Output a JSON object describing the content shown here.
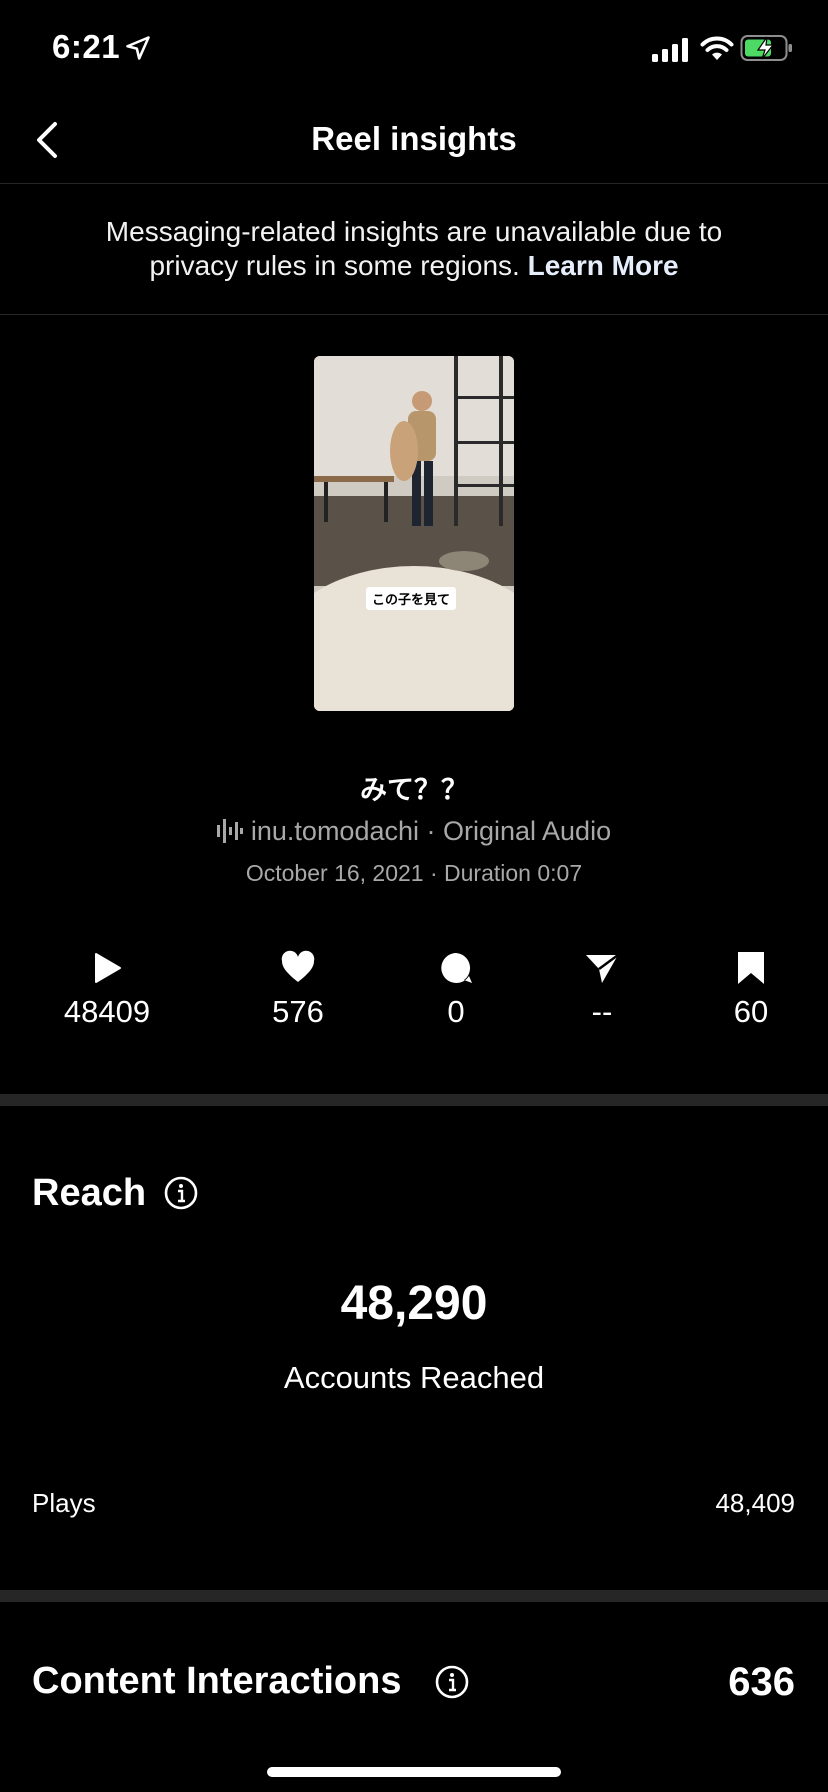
{
  "status_bar": {
    "time": "6:21"
  },
  "nav": {
    "title": "Reel insights"
  },
  "banner": {
    "text": "Messaging-related insights are unavailable due to privacy rules in some regions.",
    "link": "Learn More"
  },
  "reel": {
    "thumbnail_caption": "この子を見て",
    "title": "みて？？",
    "audio": "inu.tomodachi · Original Audio",
    "meta": "October 16, 2021 · Duration 0:07"
  },
  "stats": {
    "plays": "48409",
    "likes": "576",
    "comments": "0",
    "shares": "--",
    "saves": "60"
  },
  "reach": {
    "title": "Reach",
    "accounts_reached_value": "48,290",
    "accounts_reached_label": "Accounts Reached",
    "plays_label": "Plays",
    "plays_value": "48,409"
  },
  "interactions": {
    "title": "Content Interactions",
    "value": "636"
  },
  "colors": {
    "background": "#000000",
    "divider": "#262626",
    "secondary_text": "#a8a8a8",
    "battery_green": "#4cd964"
  }
}
